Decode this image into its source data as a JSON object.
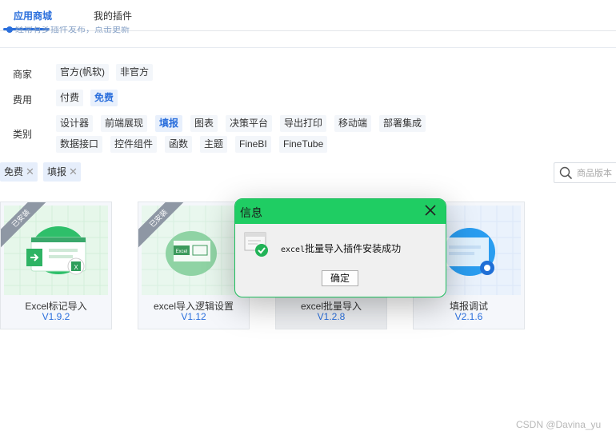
{
  "tabs": [
    {
      "label": "应用商城",
      "active": true
    },
    {
      "label": "我的插件",
      "active": false
    }
  ],
  "notice": "经常有多插件发布，点击更新",
  "filters": {
    "merchant": {
      "label": "商家",
      "options": [
        "官方(帆软)",
        "非官方"
      ]
    },
    "cost": {
      "label": "费用",
      "options": [
        "付费",
        "免费"
      ],
      "selected": "免费"
    },
    "category": {
      "label": "类别",
      "options": [
        "设计器",
        "前端展现",
        "填报",
        "图表",
        "决策平台",
        "导出打印",
        "移动端",
        "部署集成",
        "数据接口",
        "控件组件",
        "函数",
        "主题",
        "FineBI",
        "FineTube"
      ],
      "selected": "填报"
    }
  },
  "active_tags": [
    "免费",
    "填报"
  ],
  "search": {
    "placeholder": "商品版本"
  },
  "installed_badge": "已安装",
  "plugins": [
    {
      "name": "Excel标记导入",
      "version": "V1.9.2",
      "installed": true
    },
    {
      "name": "excel导入逻辑设置",
      "version": "V1.12",
      "installed": true
    },
    {
      "name": "excel批量导入",
      "version": "V1.2.8",
      "installed": false
    },
    {
      "name": "填报调试",
      "version": "V2.1.6",
      "installed": false
    }
  ],
  "dialog": {
    "title": "信息",
    "message_prefix": "excel",
    "message_rest": "批量导入插件安装成功",
    "ok_label": "确定"
  },
  "watermark": "CSDN @Davina_yu",
  "colors": {
    "accent": "#2b6fdc",
    "dialog_title": "#1fcd63",
    "success": "#22b357"
  }
}
